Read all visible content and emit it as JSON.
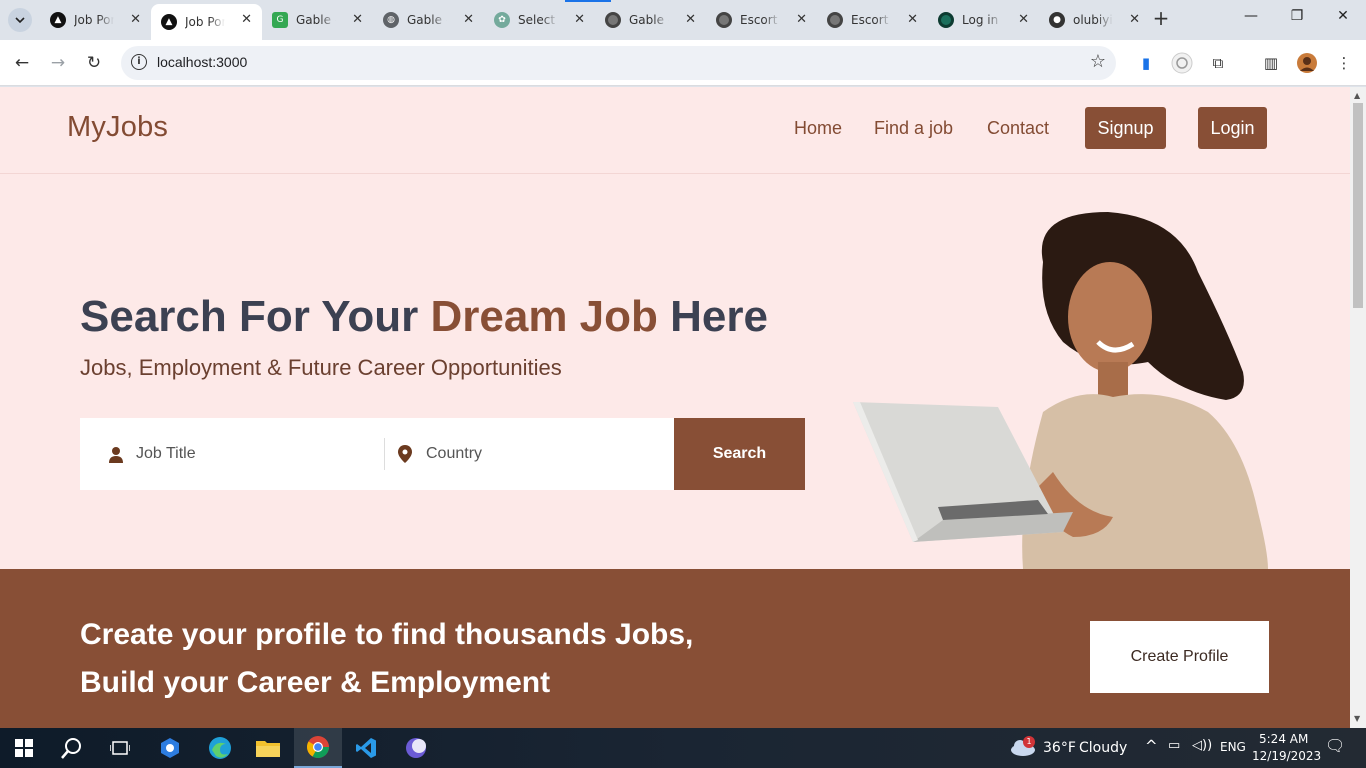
{
  "browser": {
    "tabs": [
      {
        "title": "Job Por",
        "favicon": "vercel-icon",
        "active": false
      },
      {
        "title": "Job Por",
        "favicon": "vercel-icon",
        "active": true
      },
      {
        "title": "Gable -",
        "favicon": "google-g-icon",
        "active": false
      },
      {
        "title": "Gable -",
        "favicon": "globe-icon",
        "active": false
      },
      {
        "title": "Select F",
        "favicon": "openai-icon",
        "active": false
      },
      {
        "title": "Gable -",
        "favicon": "circle-icon",
        "active": false
      },
      {
        "title": "Escort -",
        "favicon": "circle-icon",
        "active": false
      },
      {
        "title": "Escort -",
        "favicon": "circle-icon",
        "active": false
      },
      {
        "title": "Log in |",
        "favicon": "circle-icon",
        "active": false
      },
      {
        "title": "olubiyiC",
        "favicon": "github-icon",
        "active": false
      }
    ],
    "url": "localhost:3000"
  },
  "site": {
    "logo": "MyJobs",
    "nav": {
      "home": "Home",
      "find_job": "Find a job",
      "contact": "Contact",
      "signup": "Signup",
      "login": "Login"
    },
    "hero": {
      "title_part1": "Search For Your ",
      "title_accent": "Dream Job",
      "title_part2": " Here",
      "subtitle": "Jobs, Employment & Future Career Opportunities",
      "job_title_placeholder": "Job Title",
      "country_placeholder": "Country",
      "search_label": "Search"
    },
    "cta": {
      "line1": "Create your profile to find thousands Jobs,",
      "line2": "Build your Career & Employment",
      "button": "Create Profile"
    }
  },
  "taskbar": {
    "weather_temp": "36°F",
    "weather_desc": "Cloudy",
    "weather_badge": "1",
    "language": "ENG",
    "time": "5:24 AM",
    "date": "12/19/2023"
  },
  "colors": {
    "brand": "#884f36",
    "page_bg": "#fde9e8",
    "heading": "#3c4152"
  }
}
